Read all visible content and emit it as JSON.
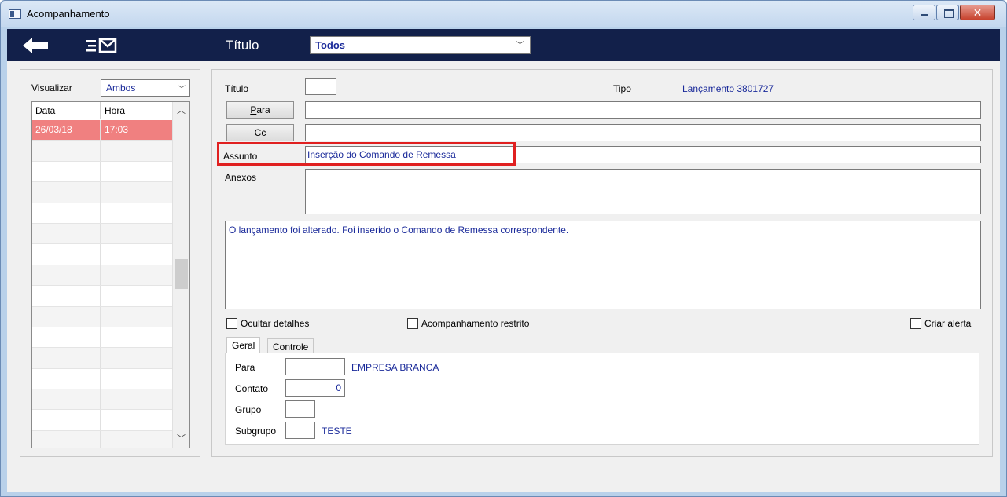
{
  "window": {
    "title": "Acompanhamento",
    "close_glyph": "✕"
  },
  "toolbar": {
    "title_label": "Título",
    "filter_value": "Todos"
  },
  "left": {
    "visualizar_label": "Visualizar",
    "visualizar_value": "Ambos",
    "columns": [
      "Data",
      "Hora"
    ],
    "rows": [
      {
        "data": "26/03/18",
        "hora": "17:03"
      }
    ]
  },
  "form": {
    "titulo_label": "Título",
    "titulo_value": "",
    "tipo_label": "Tipo",
    "tipo_value": "Lançamento 3801727",
    "para_button": "Para",
    "para_value": "",
    "cc_button": "Cc",
    "cc_value": "",
    "assunto_label": "Assunto",
    "assunto_value": "Inserção do Comando de Remessa",
    "anexos_label": "Anexos",
    "body_text": "O lançamento foi alterado. Foi inserido o Comando de Remessa correspondente.",
    "ocultar_label": "Ocultar detalhes",
    "restrito_label": "Acompanhamento restrito",
    "alerta_label": "Criar alerta"
  },
  "tabs": [
    "Geral",
    "Controle"
  ],
  "geral": {
    "para_label": "Para",
    "para_code": "",
    "para_name": "EMPRESA BRANCA",
    "contato_label": "Contato",
    "contato_value": "0",
    "grupo_label": "Grupo",
    "grupo_value": "",
    "subgrupo_label": "Subgrupo",
    "subgrupo_code": "",
    "subgrupo_name": "TESTE"
  },
  "colors": {
    "toolbar_bg": "#12204a",
    "selected_row": "#f08080",
    "value_text": "#1a2a9a",
    "highlight_border": "#e02020"
  }
}
